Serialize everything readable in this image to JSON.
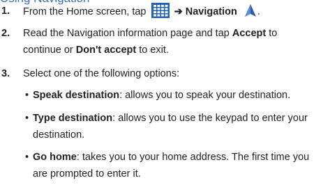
{
  "heading": "Using Navigation",
  "steps": [
    {
      "number": "1.",
      "text_before_icon": "From the Home screen, tap",
      "arrow": "➔",
      "bold_target": "Navigation",
      "end": "."
    },
    {
      "number": "2.",
      "text_a": "Read the Navigation information page and tap ",
      "accept": "Accept",
      "text_b": " to",
      "line2_a": "continue or ",
      "dont_accept": "Don't accept",
      "line2_b": " to exit."
    },
    {
      "number": "3.",
      "text": "Select one of the following options:"
    }
  ],
  "options": [
    {
      "bullet": "•",
      "label": "Speak destination",
      "desc": ": allows you to speak your destination."
    },
    {
      "bullet": "•",
      "label": "Type destination",
      "desc_line1": ": allows you to use the keypad to enter your",
      "desc_line2": "destination."
    },
    {
      "bullet": "•",
      "label": "Go home",
      "desc_line1": ": takes you to your home address. The first time you",
      "desc_line2": "are prompted to enter it."
    }
  ],
  "icons": {
    "apps_grid": "apps-grid-icon",
    "navigation": "navigation-arrow-icon"
  },
  "colors": {
    "heading": "#3a6fc0",
    "apps_icon": "#1f62b8",
    "nav_icon": "#2a5fb0"
  }
}
